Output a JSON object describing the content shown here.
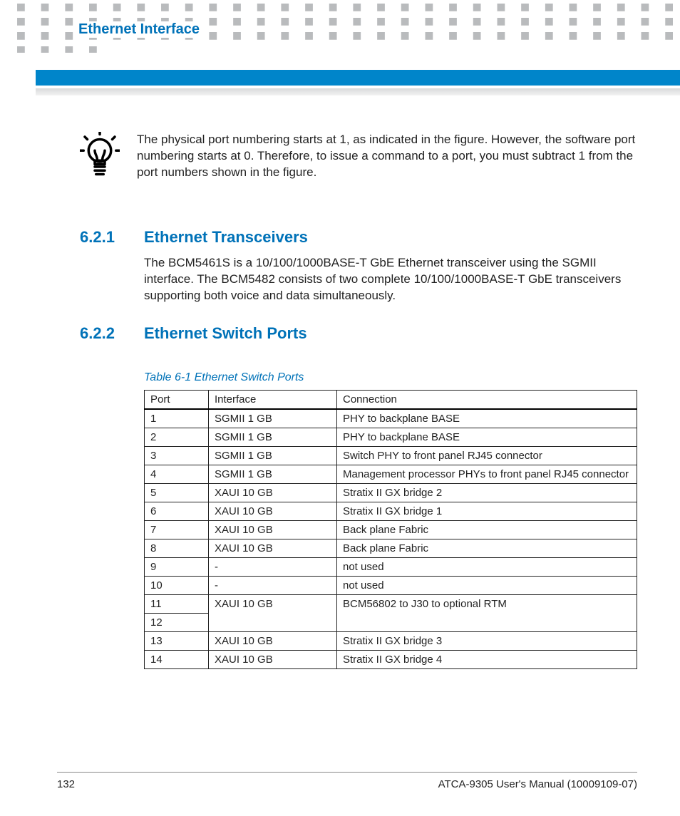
{
  "header": {
    "title": "Ethernet Interface"
  },
  "tip": {
    "text": "The physical port numbering starts at 1, as indicated in the figure. However, the software port numbering starts at 0. Therefore, to issue a command to a port, you must subtract 1 from the port numbers shown in the figure."
  },
  "sections": {
    "s1": {
      "num": "6.2.1",
      "title": "Ethernet Transceivers",
      "body": "The BCM5461S is a 10/100/1000BASE-T GbE Ethernet transceiver using the SGMII interface. The BCM5482 consists of two complete 10/100/1000BASE-T GbE transceivers supporting both voice and data simultaneously."
    },
    "s2": {
      "num": "6.2.2",
      "title": "Ethernet Switch Ports"
    }
  },
  "table": {
    "caption": "Table 6-1 Ethernet Switch Ports",
    "headers": {
      "c0": "Port",
      "c1": "Interface",
      "c2": "Connection"
    },
    "rows": [
      {
        "port": "1",
        "iface": "SGMII 1 GB",
        "conn": "PHY to backplane BASE"
      },
      {
        "port": "2",
        "iface": "SGMII 1 GB",
        "conn": "PHY to backplane BASE"
      },
      {
        "port": "3",
        "iface": "SGMII 1 GB",
        "conn": "Switch PHY to front panel RJ45 connector"
      },
      {
        "port": "4",
        "iface": "SGMII 1 GB",
        "conn": "Management processor PHYs to front panel RJ45 connector"
      },
      {
        "port": "5",
        "iface": "XAUI 10 GB",
        "conn": "Stratix II GX bridge 2"
      },
      {
        "port": "6",
        "iface": "XAUI 10 GB",
        "conn": "Stratix II GX bridge 1"
      },
      {
        "port": "7",
        "iface": "XAUI 10 GB",
        "conn": "Back plane Fabric"
      },
      {
        "port": "8",
        "iface": "XAUI 10 GB",
        "conn": "Back plane Fabric"
      },
      {
        "port": "9",
        "iface": "-",
        "conn": "not used"
      },
      {
        "port": "10",
        "iface": "-",
        "conn": "not used"
      },
      {
        "port": "11",
        "iface": "XAUI 10 GB",
        "conn": "BCM56802 to J30 to optional RTM"
      },
      {
        "port": "12",
        "iface": "",
        "conn": ""
      },
      {
        "port": "13",
        "iface": "XAUI 10 GB",
        "conn": "Stratix II GX bridge 3"
      },
      {
        "port": "14",
        "iface": "XAUI 10 GB",
        "conn": "Stratix II GX bridge 4"
      }
    ]
  },
  "footer": {
    "page": "132",
    "doc": "ATCA-9305 User's Manual (10009109-07)"
  }
}
